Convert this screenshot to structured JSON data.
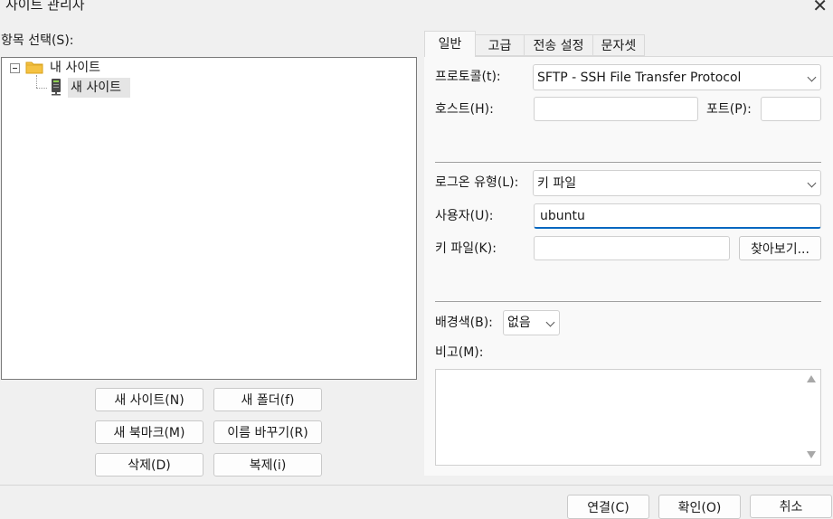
{
  "window": {
    "title": "사이트 관리자",
    "close_symbol": "✕"
  },
  "tree": {
    "label": "항목 선택(S):",
    "root": {
      "label": "내 사이트",
      "icon": "folder-icon"
    },
    "child": {
      "label": "새 사이트",
      "icon": "server-icon"
    }
  },
  "left_buttons": {
    "new_site": "새 사이트(N)",
    "new_folder": "새 폴더(f)",
    "new_bookmark": "새 북마크(M)",
    "rename": "이름 바꾸기(R)",
    "delete": "삭제(D)",
    "duplicate": "복제(i)"
  },
  "tabs": [
    "일반",
    "고급",
    "전송 설정",
    "문자셋"
  ],
  "general": {
    "protocol_label": "프로토콜(t):",
    "protocol_value": "SFTP - SSH File Transfer Protocol",
    "host_label": "호스트(H):",
    "host_value": "",
    "port_label": "포트(P):",
    "port_value": "",
    "logon_type_label": "로그온 유형(L):",
    "logon_type_value": "키 파일",
    "user_label": "사용자(U):",
    "user_value": "ubuntu",
    "key_file_label": "키 파일(K):",
    "key_file_value": "",
    "browse_button": "찾아보기...",
    "bg_color_label": "배경색(B):",
    "bg_color_value": "없음",
    "comments_label": "비고(M):",
    "comments_value": ""
  },
  "footer": {
    "connect": "연결(C)",
    "ok": "확인(O)",
    "cancel": "취소"
  },
  "colors": {
    "background": "#f0f0f0",
    "panel": "#f9f9f9",
    "focus_accent": "#0067c0",
    "folder": "#f5c242"
  }
}
